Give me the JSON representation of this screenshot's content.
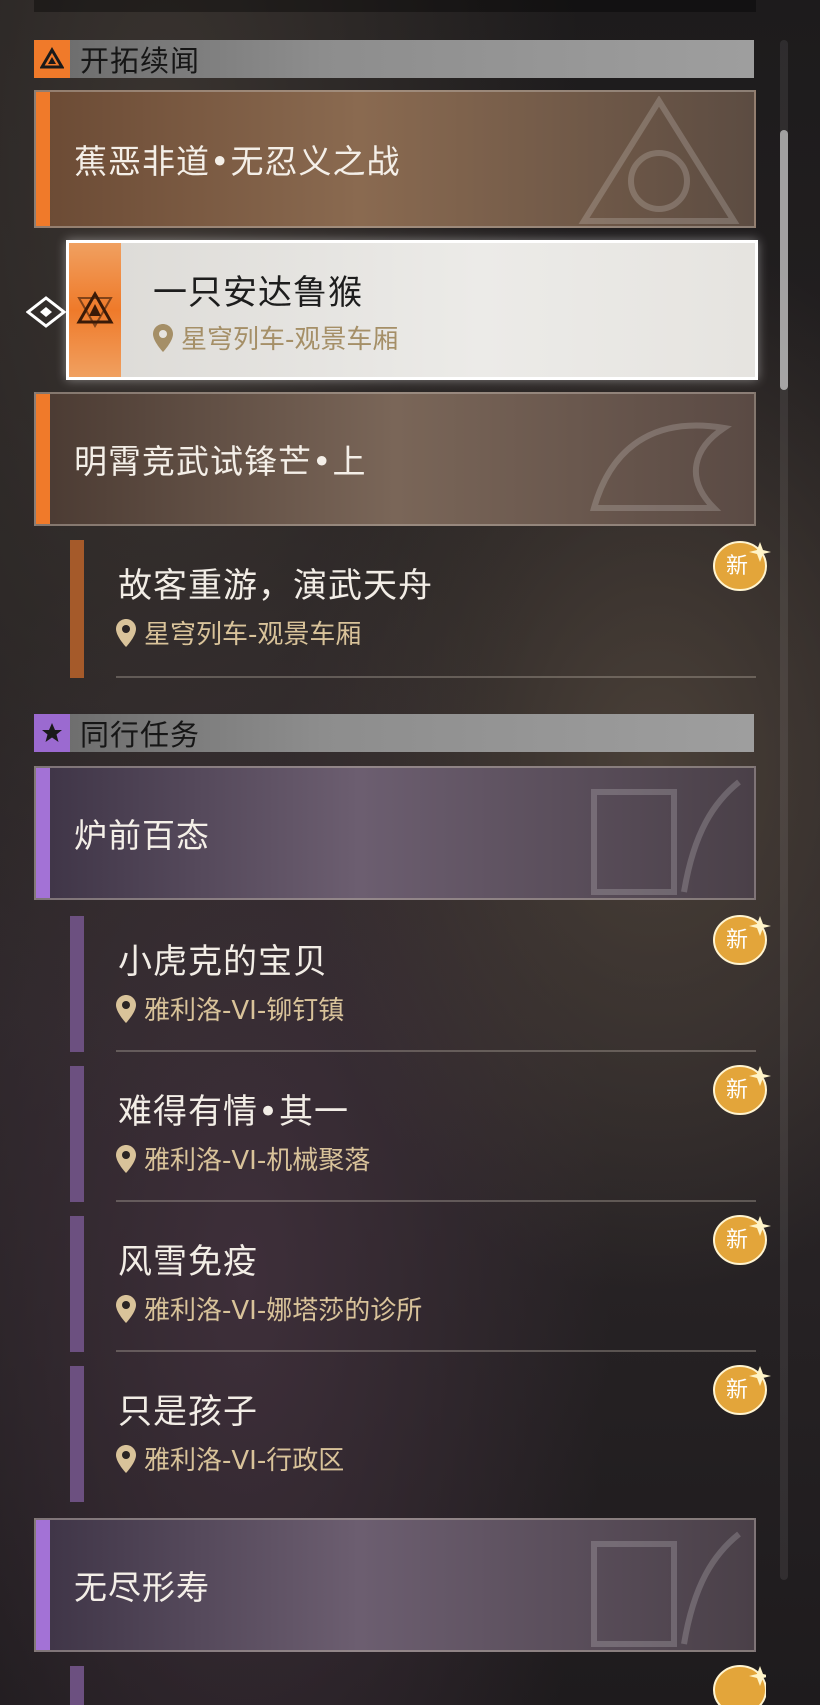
{
  "sections": [
    {
      "title": "开拓续闻",
      "icon": "trailblaze-triangle-icon",
      "color": "#f07a2a"
    },
    {
      "title": "同行任务",
      "icon": "companion-star-icon",
      "color": "#9b6ad0"
    }
  ],
  "groups": [
    {
      "title": "蕉恶非道•无忍义之战",
      "accent": "#f07a2a"
    },
    {
      "title": "明霄竞武试锋芒•上",
      "accent": "#f07a2a"
    },
    {
      "title": "炉前百态",
      "accent": "#a372d6"
    },
    {
      "title": "无尽形寿",
      "accent": "#a372d6"
    }
  ],
  "selected_quest": {
    "title": "一只安达鲁猴",
    "location": "星穹列车-观景车厢"
  },
  "quests": [
    {
      "title": "故客重游，演武天舟",
      "location": "星穹列车-观景车厢",
      "badge": "新"
    },
    {
      "title": "小虎克的宝贝",
      "location": "雅利洛-VI-铆钉镇",
      "badge": "新"
    },
    {
      "title": "难得有情•其一",
      "location": "雅利洛-VI-机械聚落",
      "badge": "新"
    },
    {
      "title": "风雪免疫",
      "location": "雅利洛-VI-娜塔莎的诊所",
      "badge": "新"
    },
    {
      "title": "只是孩子",
      "location": "雅利洛-VI-行政区",
      "badge": "新"
    }
  ],
  "scrollbar": {
    "position": 0.06
  }
}
